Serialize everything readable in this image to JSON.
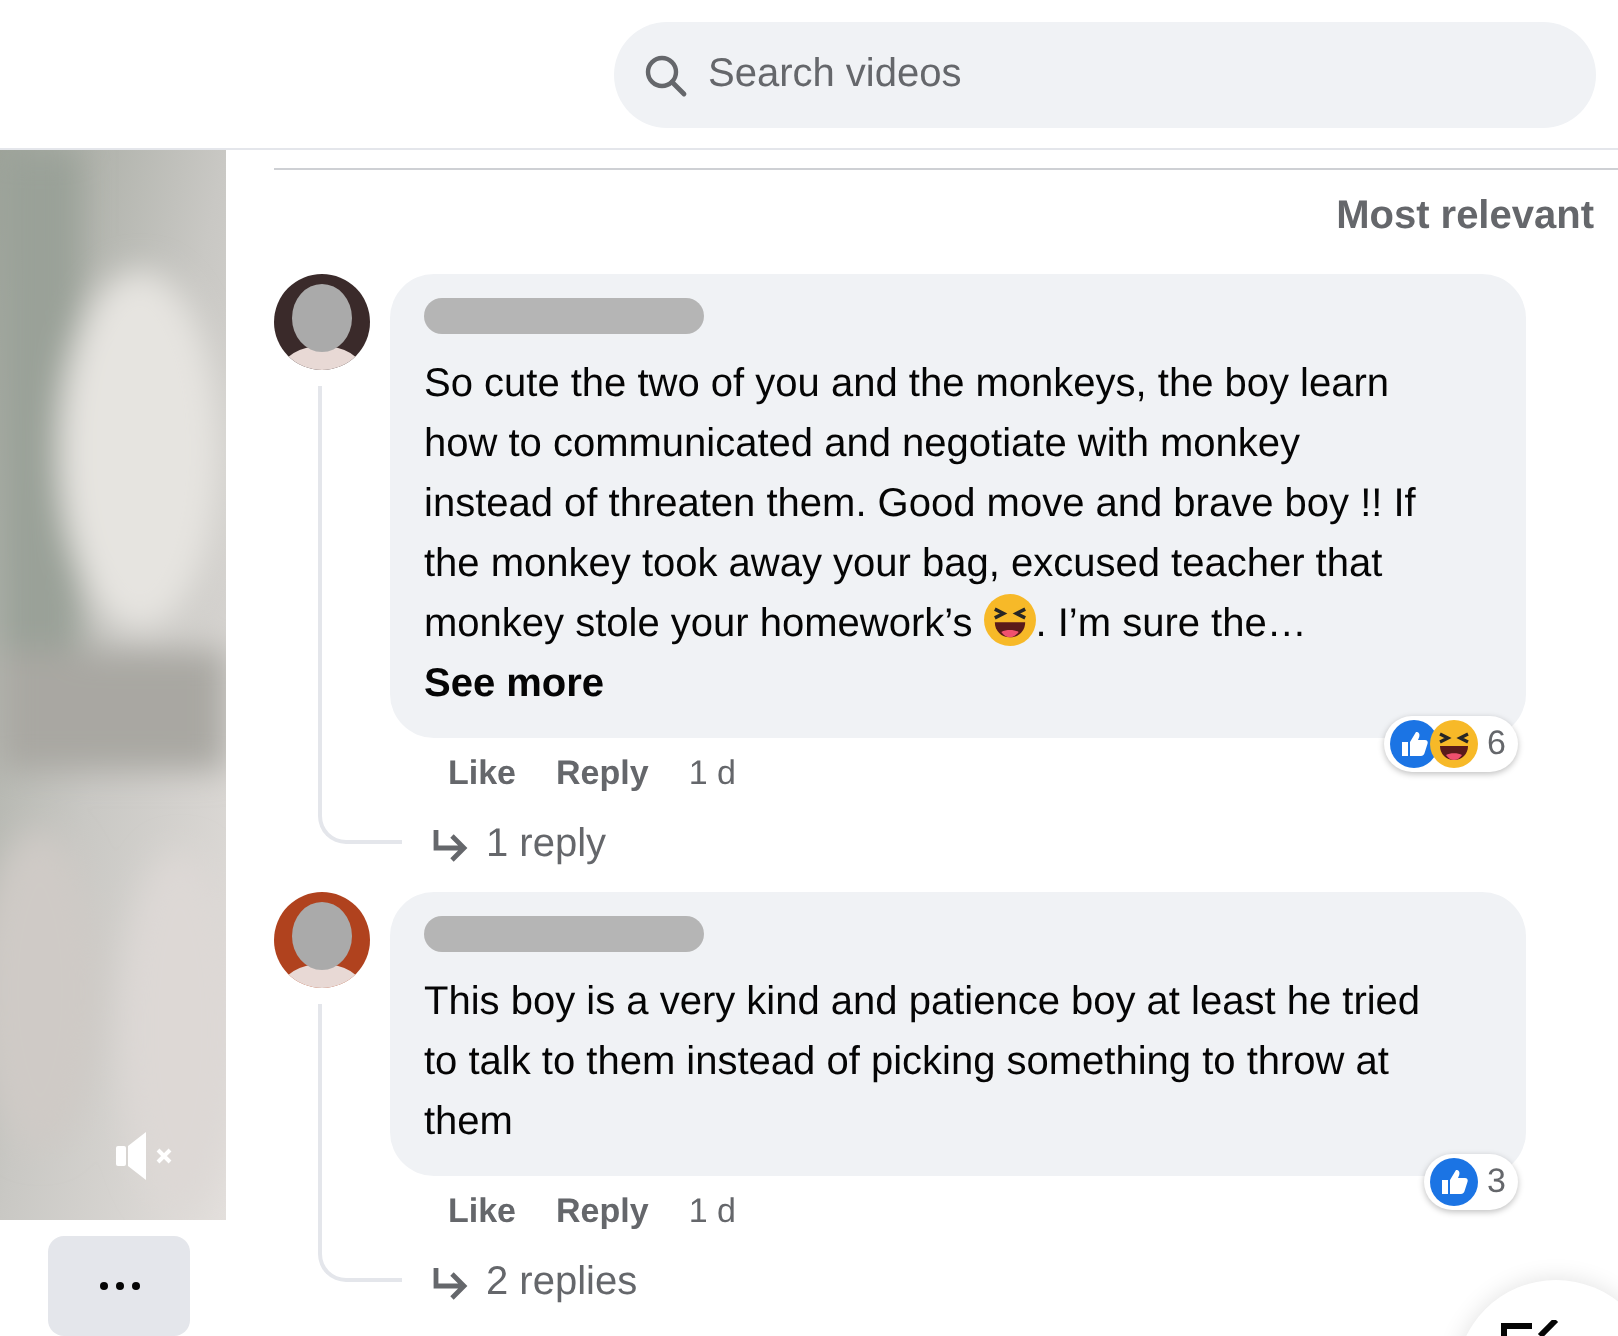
{
  "search": {
    "placeholder": "Search videos"
  },
  "video": {
    "kind": "picture",
    "muted": true
  },
  "sort": {
    "label": "Most relevant"
  },
  "comments": [
    {
      "segments": [
        {
          "kind": "text",
          "text": "So cute the two of you and the monkeys, the boy learn how to communicated and negotiate with monkey instead of threaten them. Good move and brave boy !! If the monkey took away your bag, excused teacher that monkey stole your homework’s"
        },
        {
          "kind": "emoji"
        },
        {
          "kind": "text",
          "text": ". I’m sure the…"
        },
        {
          "kind": "link",
          "text": "See more"
        }
      ],
      "reactions": [
        {
          "kind": "like"
        },
        {
          "kind": "haha"
        }
      ],
      "reaction_count": "6",
      "actions": [
        "Like",
        "Reply"
      ],
      "time": "1 d",
      "replies": "1 reply"
    },
    {
      "segments": [
        {
          "kind": "text",
          "text": "This boy is a very kind and patience boy at least he tried to talk to them instead of picking something to throw at them"
        }
      ],
      "reactions": [
        {
          "kind": "like"
        }
      ],
      "reaction_count": "3",
      "actions": [
        "Like",
        "Reply"
      ],
      "time": "1 d",
      "replies": "2 replies"
    }
  ]
}
